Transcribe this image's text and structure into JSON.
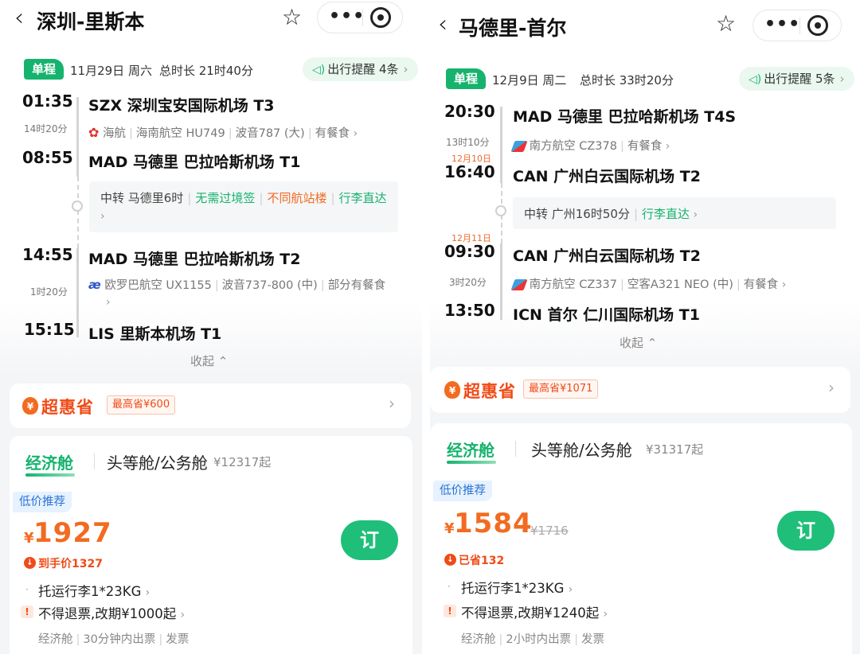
{
  "panels": [
    {
      "title": "深圳-里斯本",
      "trip_type": "单程",
      "date": "11月29日 周六",
      "total_duration": "总时长 21时40分",
      "reminder": "出行提醒 4条",
      "segments": [
        {
          "dep_time": "01:35",
          "dep_airport": "SZX 深圳宝安国际机场 T3",
          "duration": "14时20分",
          "airline": [
            "海航",
            "海南航空 HU749",
            "波音787 (大)",
            "有餐食"
          ],
          "arr_time": "08:55",
          "arr_airport": "MAD 马德里 巴拉哈斯机场 T1"
        },
        {
          "dep_time": "14:55",
          "dep_airport": "MAD 马德里 巴拉哈斯机场 T2",
          "duration": "1时20分",
          "airline": [
            "欧罗巴航空 UX1155",
            "波音737-800 (中)",
            "部分有餐食"
          ],
          "arr_time": "15:15",
          "arr_airport": "LIS 里斯本机场 T1"
        }
      ],
      "transfer": {
        "city": "中转 马德里6时",
        "tags": [
          "无需过境签",
          "不同航站楼",
          "行李直达"
        ]
      },
      "collapse": "收起",
      "super_save": {
        "logo": "超惠省",
        "badge": "最高省¥600"
      },
      "tabs": {
        "active": "经济舱",
        "other": "头等舱/公务舱",
        "other_price": "¥12317起"
      },
      "offer": {
        "tag": "低价推荐",
        "yen": "¥",
        "price": "1927",
        "old_price": "",
        "sub": "到手价1327",
        "book": "订",
        "baggage": "托运行李1*23KG",
        "refund": "不得退票,改期¥1000起",
        "footnote": [
          "经济舱",
          "30分钟内出票",
          "发票"
        ]
      }
    },
    {
      "title": "马德里-首尔",
      "trip_type": "单程",
      "date": "12月9日 周二",
      "total_duration": "总时长 33时20分",
      "reminder": "出行提醒 5条",
      "segments": [
        {
          "dep_time": "20:30",
          "dep_airport": "MAD 马德里 巴拉哈斯机场 T4S",
          "duration": "13时10分",
          "airline": [
            "南方航空 CZ378",
            "有餐食"
          ],
          "arr_day": "12月10日",
          "arr_time": "16:40",
          "arr_airport": "CAN 广州白云国际机场 T2"
        },
        {
          "dep_day": "12月11日",
          "dep_time": "09:30",
          "dep_airport": "CAN 广州白云国际机场 T2",
          "duration": "3时20分",
          "airline": [
            "南方航空 CZ337",
            "空客A321 NEO (中)",
            "有餐食"
          ],
          "arr_time": "13:50",
          "arr_airport": "ICN 首尔 仁川国际机场 T1"
        }
      ],
      "transfer": {
        "city": "中转 广州16时50分",
        "tags": [
          "行李直达"
        ]
      },
      "collapse": "收起",
      "super_save": {
        "logo": "超惠省",
        "badge": "最高省¥1071"
      },
      "tabs": {
        "active": "经济舱",
        "other": "头等舱/公务舱",
        "other_price": "¥31317起"
      },
      "offer": {
        "tag": "低价推荐",
        "yen": "¥",
        "price": "1584",
        "old_price": "¥1716",
        "sub": "已省132",
        "book": "订",
        "baggage": "托运行李1*23KG",
        "refund": "不得退票,改期¥1240起",
        "footnote": [
          "经济舱",
          "2小时内出票",
          "发票"
        ]
      }
    }
  ],
  "icons": {
    "back": "chevron-left-icon",
    "star": "star-icon",
    "more": "more-dots-icon",
    "target": "target-icon"
  },
  "colors": {
    "accent_green": "#16b36e",
    "price_orange": "#f26b21",
    "low_tag_blue": "#2c73d2"
  }
}
